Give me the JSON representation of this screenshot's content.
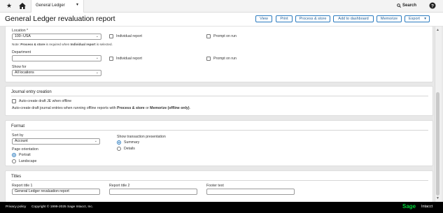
{
  "nav": {
    "tab_label": "General Ledger",
    "search_label": "Search"
  },
  "header": {
    "title": "General Ledger revaluation report",
    "buttons": [
      "View",
      "Print",
      "Process & store",
      "Add to dashboard",
      "Memorize",
      "Export"
    ]
  },
  "filters": {
    "location_label": "Location *",
    "location_value": "100--USA",
    "individual_report_1": "Individual report",
    "prompt_on_run_1": "Prompt on run",
    "note_prefix": "Note: ",
    "note_bold1": "Process & store",
    "note_mid": " is required when ",
    "note_bold2": "Individual report",
    "note_suffix": " is selected.",
    "department_label": "Department",
    "department_value": "",
    "individual_report_2": "Individual report",
    "prompt_on_run_2": "Prompt on run",
    "show_for_label": "Show for",
    "show_for_value": "All locations"
  },
  "journal": {
    "title": "Journal entry creation",
    "checkbox_label": "Auto-create draft JE when offline",
    "desc_prefix": "Auto-create draft journal entries when running offline reports with ",
    "desc_bold1": "Process & store",
    "desc_mid": " or ",
    "desc_bold2": "Memorize (offline only)",
    "desc_suffix": "."
  },
  "format": {
    "title": "Format",
    "sort_by_label": "Sort by",
    "sort_by_value": "Account",
    "orientation_label": "Page orientation",
    "portrait": "Portrait",
    "landscape": "Landscape",
    "presentation_label": "Show transaction presentation",
    "summary": "Summary",
    "details": "Details"
  },
  "titles": {
    "title": "Titles",
    "report_title_1_label": "Report title 1",
    "report_title_1_value": "General Ledger revaluation report",
    "report_title_2_label": "Report title 2",
    "report_title_2_value": "",
    "footer_text_label": "Footer text",
    "footer_text_value": ""
  },
  "footer": {
    "privacy": "Privacy policy",
    "copyright": "Copyright © 1999-2025 Sage Intacct, Inc.",
    "brand": "Sage",
    "product": "Intacct"
  },
  "colors": {
    "accent": "#2b7bbf",
    "brand_green": "#00d639",
    "footer_bg": "#000000"
  }
}
